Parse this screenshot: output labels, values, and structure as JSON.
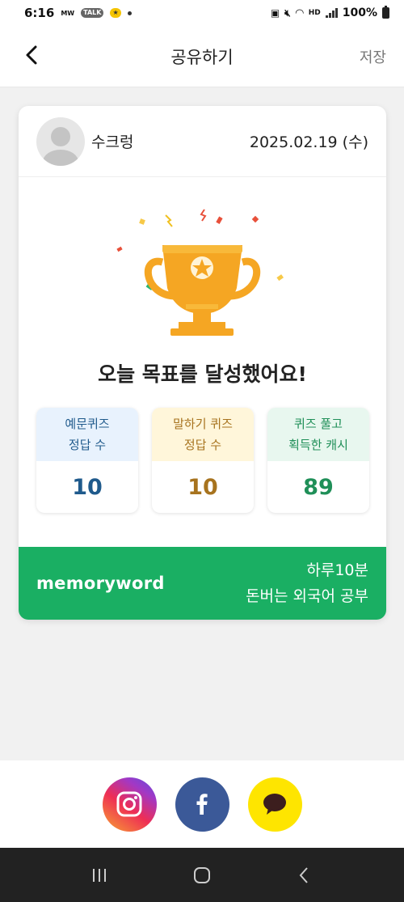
{
  "status_bar": {
    "time": "6:16",
    "mw_badge": "MW",
    "talk_badge": "TALK",
    "network": "HD",
    "battery": "100%"
  },
  "header": {
    "title": "공유하기",
    "save_label": "저장"
  },
  "card": {
    "username": "수크렁",
    "date": "2025.02.19 (수)",
    "goal_message": "오늘 목표를 달성했어요!",
    "stats": [
      {
        "label": "예문퀴즈\n정답 수",
        "value": "10",
        "header_bg": "#e8f2fd",
        "color": "#1f5a8c"
      },
      {
        "label": "말하기 퀴즈\n정답 수",
        "value": "10",
        "header_bg": "#fff6da",
        "color": "#a7731e"
      },
      {
        "label": "퀴즈 풀고\n획득한 캐시",
        "value": "89",
        "header_bg": "#e8f7ef",
        "color": "#1f8f58"
      }
    ],
    "brand": "memoryword",
    "slogan_line1": "하루10분",
    "slogan_line2": "돈버는 외국어 공부",
    "brand_color": "#1aaf63"
  },
  "share": {
    "buttons": [
      "instagram-icon",
      "facebook-icon",
      "kakaotalk-icon"
    ]
  }
}
